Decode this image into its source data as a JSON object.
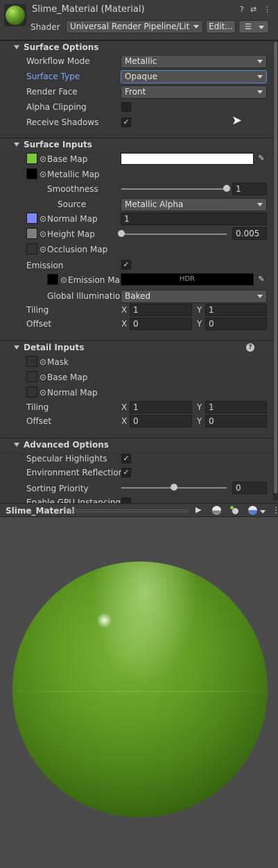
{
  "header": {
    "title": "Slime_Material (Material)",
    "shader_label": "Shader",
    "shader_value": "Universal Render Pipeline/Lit",
    "edit_label": "Edit...",
    "help_glyph": "?",
    "settings_glyph": "⇄",
    "more_glyph": "⋮"
  },
  "surface_options": {
    "title": "Surface Options",
    "workflow_mode": {
      "label": "Workflow Mode",
      "value": "Metallic"
    },
    "surface_type": {
      "label": "Surface Type",
      "value": "Opaque"
    },
    "render_face": {
      "label": "Render Face",
      "value": "Front"
    },
    "alpha_clipping": {
      "label": "Alpha Clipping",
      "checked": false
    },
    "receive_shadows": {
      "label": "Receive Shadows",
      "checked": true,
      "mark": "✓"
    }
  },
  "surface_inputs": {
    "title": "Surface Inputs",
    "base_map": {
      "label": "Base Map",
      "color": "#7bc63a"
    },
    "metallic_map": {
      "label": "Metallic Map",
      "color": "#000000"
    },
    "smoothness": {
      "label": "Smoothness",
      "value": "1",
      "fraction": 1.0
    },
    "source": {
      "label": "Source",
      "value": "Metallic Alpha"
    },
    "normal_map": {
      "label": "Normal Map",
      "value": "1",
      "color": "#7f85f5"
    },
    "height_map": {
      "label": "Height Map",
      "value": "0.005",
      "fraction": 0.0,
      "color": "#7f7f7f"
    },
    "occlusion_map": {
      "label": "Occlusion Map"
    },
    "emission": {
      "label": "Emission",
      "checked": true,
      "mark": "✓"
    },
    "emission_map": {
      "label": "Emission Map",
      "hdr": "HDR"
    },
    "global_illumination": {
      "label": "Global Illumination",
      "value": "Baked"
    },
    "tiling": {
      "label": "Tiling",
      "x_label": "X",
      "x": "1",
      "y_label": "Y",
      "y": "1"
    },
    "offset": {
      "label": "Offset",
      "x_label": "X",
      "x": "0",
      "y_label": "Y",
      "y": "0"
    }
  },
  "detail_inputs": {
    "title": "Detail Inputs",
    "help_glyph": "?",
    "mask": {
      "label": "Mask"
    },
    "base_map": {
      "label": "Base Map"
    },
    "normal_map": {
      "label": "Normal Map"
    },
    "tiling": {
      "label": "Tiling",
      "x_label": "X",
      "x": "1",
      "y_label": "Y",
      "y": "1"
    },
    "offset": {
      "label": "Offset",
      "x_label": "X",
      "x": "0",
      "y_label": "Y",
      "y": "0"
    }
  },
  "advanced_options": {
    "title": "Advanced Options",
    "specular_highlights": {
      "label": "Specular Highlights",
      "checked": true,
      "mark": "✓"
    },
    "environment_reflections": {
      "label": "Environment Reflections",
      "checked": true,
      "mark": "✓"
    },
    "sorting_priority": {
      "label": "Sorting Priority",
      "value": "0",
      "fraction": 0.5
    },
    "gpu_instancing": {
      "label": "Enable GPU Instancing"
    }
  },
  "preview": {
    "title": "Slime_Material",
    "play_glyph": "▶",
    "more_glyph": "⋮"
  },
  "colors": {
    "accent_blue": "#7fa8ff",
    "panel_bg": "#383838"
  }
}
